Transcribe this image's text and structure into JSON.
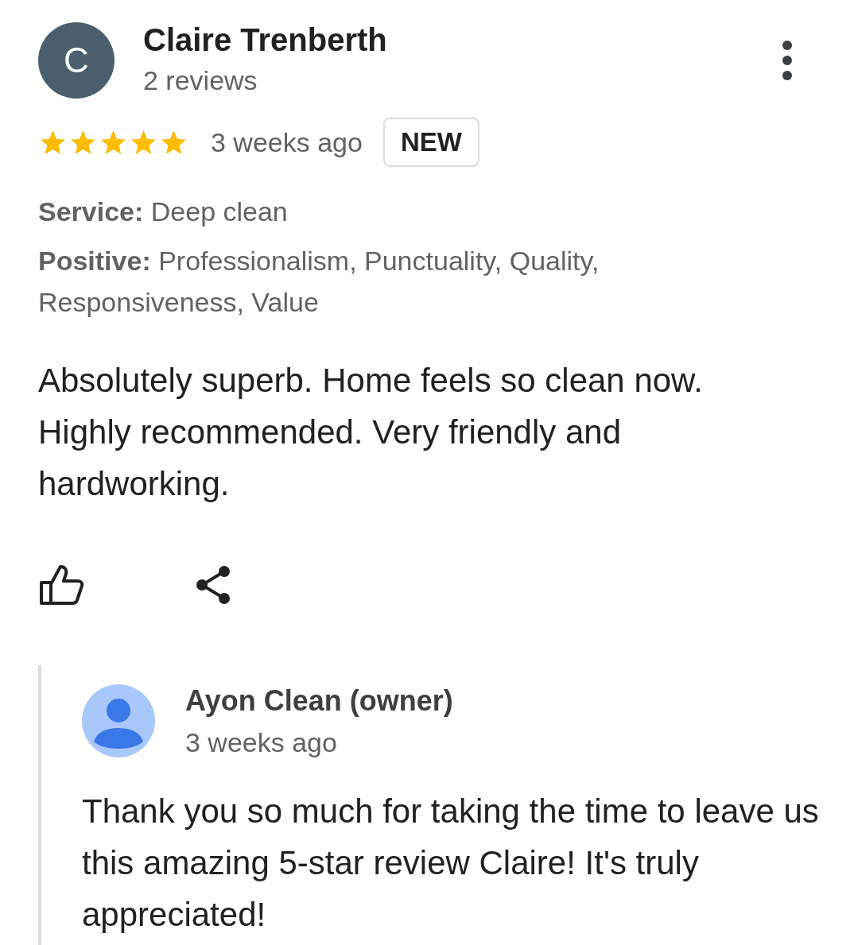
{
  "reviewer": {
    "initial": "C",
    "name": "Claire Trenberth",
    "review_count": "2 reviews"
  },
  "stars": 5,
  "time": "3 weeks ago",
  "badge": "NEW",
  "details": [
    "**Service:** Deep clean",
    "**Positive:** Professionalism, Punctuality, Quality, Responsiveness, Value"
  ],
  "text": "Absolutely superb. Home feels so clean now. Highly recommended. Very friendly and hardworking.",
  "reply": {
    "name": "Ayon Clean (owner)",
    "time": "3 weeks ago",
    "text": "Thank you so much for taking the time to leave us this amazing 5-star review Claire! It's truly appreciated!"
  }
}
